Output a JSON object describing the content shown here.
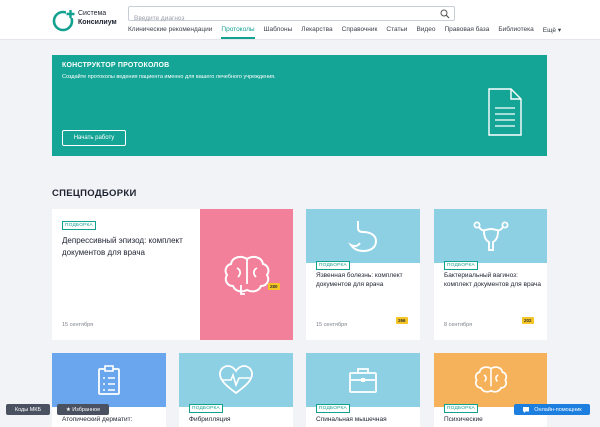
{
  "header": {
    "logo_line1": "Система",
    "logo_line2": "Консилиум",
    "search_placeholder": "Введите диагноз",
    "nav": [
      {
        "label": "Клинические рекомендации"
      },
      {
        "label": "Протоколы"
      },
      {
        "label": "Шаблоны"
      },
      {
        "label": "Лекарства"
      },
      {
        "label": "Справочник"
      },
      {
        "label": "Статьи"
      },
      {
        "label": "Видео"
      },
      {
        "label": "Правовая база"
      },
      {
        "label": "Библиотека"
      },
      {
        "label": "Ещё ▾"
      }
    ],
    "active_nav": "Протоколы"
  },
  "banner": {
    "title": "КОНСТРУКТОР ПРОТОКОЛОВ",
    "subtitle": "Создайте протоколы ведения пациента именно для вашего лечебного учреждения.",
    "button": "Начать работу"
  },
  "section": {
    "title": "СПЕЦПОДБОРКИ"
  },
  "cards": [
    {
      "tag": "ПОДБОРКА",
      "title": "Депрессивный эпизод: комплект документов для врача",
      "date": "15 сентября",
      "badge": "280",
      "icon": "brain-icon",
      "color": "#f3809a"
    },
    {
      "tag": "ПОДБОРКА",
      "title": "Язвенная болезнь: комплект документов для врача",
      "date": "15 сентября",
      "badge": "266",
      "icon": "stomach-icon",
      "color": "#8dd0e3"
    },
    {
      "tag": "ПОДБОРКА",
      "title": "Бактериальный вагиноз: комплект документов для врача",
      "date": "8 сентября",
      "badge": "202",
      "icon": "uterus-icon",
      "color": "#8dd0e3"
    },
    {
      "tag": "",
      "title": "Атопический дерматит:",
      "date": "",
      "badge": "",
      "icon": "clipboard-icon",
      "color": "#6aa6ee"
    },
    {
      "tag": "ПОДБОРКА",
      "title": "Фибрилляция",
      "date": "",
      "badge": "",
      "icon": "heart-pulse-icon",
      "color": "#8dd0e3"
    },
    {
      "tag": "ПОДБОРКА",
      "title": "Спинальная мышечная",
      "date": "",
      "badge": "",
      "icon": "briefcase-icon",
      "color": "#8dd0e3"
    },
    {
      "tag": "ПОДБОРКА",
      "title": "Психические",
      "date": "",
      "badge": "",
      "icon": "brain-icon",
      "color": "#f5b25a"
    }
  ],
  "footer": {
    "mkb": "Коды МКБ",
    "favorites": "★ Избранное",
    "online": "Онлайн-помощник"
  }
}
